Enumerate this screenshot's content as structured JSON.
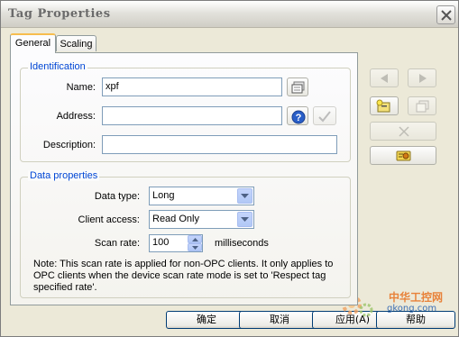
{
  "window": {
    "title": "Tag Properties"
  },
  "tabs": [
    {
      "label": "General",
      "active": true
    },
    {
      "label": "Scaling",
      "active": false
    }
  ],
  "identification": {
    "title": "Identification",
    "name_label": "Name:",
    "name_value": "xpf",
    "address_label": "Address:",
    "address_value": "",
    "description_label": "Description:",
    "description_value": ""
  },
  "data_properties": {
    "title": "Data properties",
    "data_type_label": "Data type:",
    "data_type_value": "Long",
    "client_access_label": "Client access:",
    "client_access_value": "Read Only",
    "scan_rate_label": "Scan rate:",
    "scan_rate_value": "100",
    "scan_rate_unit": "milliseconds",
    "note": "Note: This scan rate is applied for non-OPC clients. It only applies to OPC clients when the device scan rate mode is set to 'Respect tag specified rate'."
  },
  "buttons": {
    "ok": "确定",
    "cancel": "取消",
    "apply": "应用(A)",
    "help": "帮助"
  },
  "watermark": {
    "cn": "中华工控网",
    "url": "gkong.com"
  },
  "colors": {
    "group_title": "#0046d5",
    "dialog_bg": "#ece9d8",
    "tab_highlight": "#f7bd4e"
  }
}
